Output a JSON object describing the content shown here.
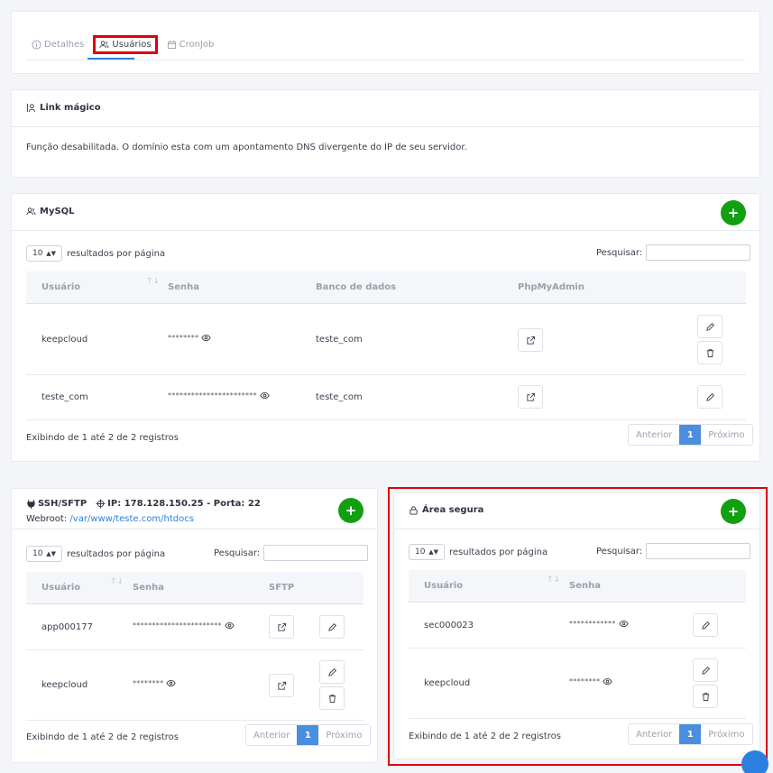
{
  "tabs": [
    {
      "label": "Detalhes",
      "icon": "info-icon"
    },
    {
      "label": "Usuários",
      "icon": "users-icon"
    },
    {
      "label": "CronJob",
      "icon": "calendar-icon"
    }
  ],
  "magic_link": {
    "title": "Link mágico",
    "message": "Função desabilitada. O domínio esta com um apontamento DNS divergente do IP de seu servidor."
  },
  "common": {
    "page_len": "10",
    "per_page_label": "resultados por página",
    "search_label": "Pesquisar:",
    "prev": "Anterior",
    "next": "Próximo",
    "page": "1",
    "info": "Exibindo de 1 até 2 de 2 registros",
    "add": "+"
  },
  "mysql": {
    "title": "MySQL",
    "columns": [
      "Usuário",
      "Senha",
      "Banco de dados",
      "PhpMyAdmin"
    ],
    "rows": [
      {
        "user": "keepcloud",
        "password": "********",
        "database": "teste_com"
      },
      {
        "user": "teste_com",
        "password": "***********************",
        "database": "teste_com"
      }
    ]
  },
  "ssh": {
    "title": "SSH/SFTP",
    "ip_text": "IP: 178.128.150.25 - Porta: 22",
    "webroot_label": "Webroot:",
    "webroot_path": "/var/www/teste.com/htdocs",
    "columns": [
      "Usuário",
      "Senha",
      "SFTP"
    ],
    "rows": [
      {
        "user": "app000177",
        "password": "***********************"
      },
      {
        "user": "keepcloud",
        "password": "********"
      }
    ]
  },
  "secure": {
    "title": "Área segura",
    "columns": [
      "Usuário",
      "Senha"
    ],
    "rows": [
      {
        "user": "sec000023",
        "password": "************"
      },
      {
        "user": "keepcloud",
        "password": "********"
      }
    ]
  },
  "colors": {
    "accent": "#2d7fe0",
    "add_green": "#12a012",
    "highlight": "#e0000d"
  }
}
